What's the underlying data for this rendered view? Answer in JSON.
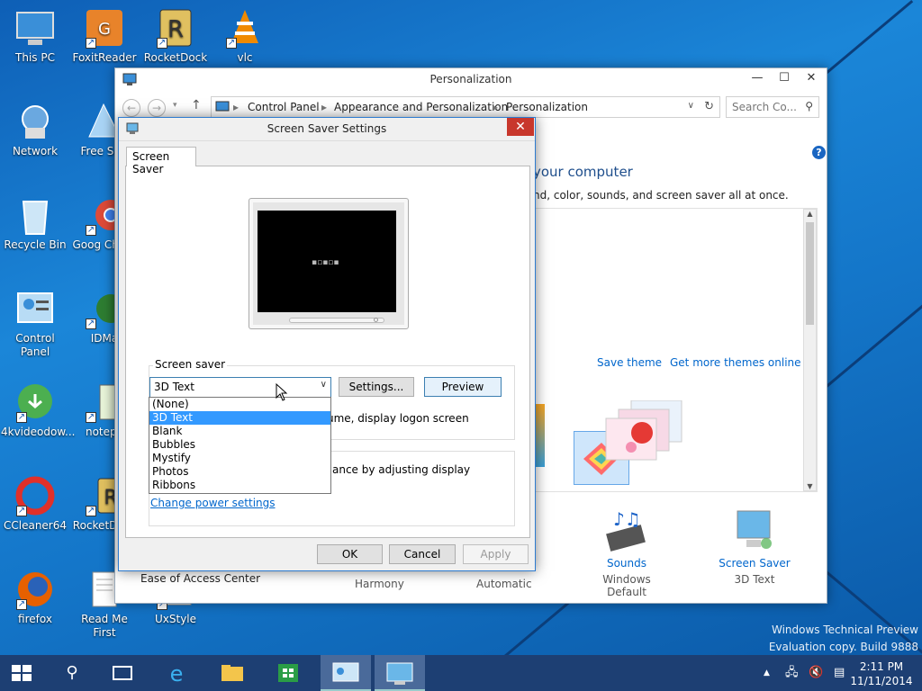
{
  "desktop": {
    "icons": [
      {
        "label": "This PC",
        "icon": "computer-icon"
      },
      {
        "label": "FoxitReader",
        "icon": "pdf-icon"
      },
      {
        "label": "RocketDock",
        "icon": "rocketdock-icon"
      },
      {
        "label": "vlc",
        "icon": "vlc-icon"
      },
      {
        "label": "Network",
        "icon": "network-icon"
      },
      {
        "label": "Free Soft",
        "icon": "free-soft-icon"
      },
      {
        "label": "Recycle Bin",
        "icon": "recycle-bin-icon"
      },
      {
        "label": "Goog Chron",
        "icon": "chrome-icon"
      },
      {
        "label": "Control Panel",
        "icon": "control-panel-icon"
      },
      {
        "label": "IDMa",
        "icon": "idm-icon"
      },
      {
        "label": "4kvideodow...",
        "icon": "4kvideo-icon"
      },
      {
        "label": "notepa",
        "icon": "notepad-icon"
      },
      {
        "label": "CCleaner64",
        "icon": "ccleaner-icon"
      },
      {
        "label": "RocketD (2)",
        "icon": "rocketdock-icon"
      },
      {
        "label": "firefox",
        "icon": "firefox-icon"
      },
      {
        "label": "Read Me First",
        "icon": "document-icon"
      },
      {
        "label": "UxStyle",
        "icon": "uxstyle-icon"
      }
    ],
    "watermark": [
      "Windows Technical Preview",
      "Evaluation copy. Build 9888"
    ]
  },
  "personalization": {
    "title": "Personalization",
    "breadcrumb": [
      "Control Panel",
      "Appearance and Personalization",
      "Personalization"
    ],
    "search_placeholder": "Search Co...",
    "heading_partial": "your computer",
    "subtext_partial": "nd, color, sounds, and screen saver all at once.",
    "links": {
      "save_theme": "Save theme",
      "get_more": "Get more themes online"
    },
    "bottom": [
      {
        "label": "Harmony",
        "sub": ""
      },
      {
        "label": "Automatic",
        "sub": ""
      },
      {
        "label": "Sounds",
        "sub": "Windows Default"
      },
      {
        "label": "Screen Saver",
        "sub": "3D Text"
      }
    ],
    "ease_of_access": "Ease of Access Center"
  },
  "screensaver_dialog": {
    "title": "Screen Saver Settings",
    "tab": "Screen Saver",
    "group_label": "Screen saver",
    "selected": "3D Text",
    "settings_btn": "Settings...",
    "preview_btn": "Preview",
    "resume_text_partial": "ume, display logon screen",
    "power_text_partial": "ance by adjusting display",
    "power_link": "Change power settings",
    "ok": "OK",
    "cancel": "Cancel",
    "apply": "Apply",
    "options": [
      "(None)",
      "3D Text",
      "Blank",
      "Bubbles",
      "Mystify",
      "Photos",
      "Ribbons"
    ]
  },
  "taskbar": {
    "time": "2:11 PM",
    "date": "11/11/2014"
  },
  "colors": {
    "accent": "#3399ff",
    "link": "#0066cc",
    "taskbar": "#1d3f73"
  }
}
